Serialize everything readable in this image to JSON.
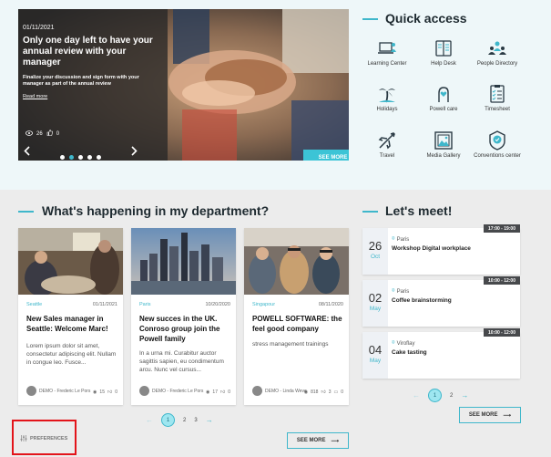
{
  "hero": {
    "date": "01/11/2021",
    "title": "Only one day left to have your annual review with your manager",
    "description": "Finalize your discussion and sign form with your manager as part of the annual review",
    "read_more": "Read more",
    "views": "26",
    "likes": "0",
    "prev_icon": "chevron-left-icon",
    "next_icon": "chevron-right-icon",
    "slide_count": 5,
    "active_slide": 2,
    "see_more": "SEE MORE"
  },
  "quick_access": {
    "title": "Quick access",
    "items": [
      {
        "label": "Learning Center",
        "icon": "laptop-person-icon"
      },
      {
        "label": "Help Desk",
        "icon": "book-icon"
      },
      {
        "label": "People Directory",
        "icon": "people-icon"
      },
      {
        "label": "Holidays",
        "icon": "palm-tree-icon"
      },
      {
        "label": "Powell care",
        "icon": "hand-heart-icon"
      },
      {
        "label": "Timesheet",
        "icon": "checklist-icon"
      },
      {
        "label": "Travel",
        "icon": "airplane-icon"
      },
      {
        "label": "Media Gallery",
        "icon": "picture-icon"
      },
      {
        "label": "Conventions center",
        "icon": "badge-check-icon"
      }
    ]
  },
  "department": {
    "title": "What's happening in my department?",
    "cards": [
      {
        "location": "Seattle",
        "date": "01/11/2021",
        "title": "New Sales manager in Seattle: Welcome Marc!",
        "excerpt": "Lorem ipsum dolor sit amet, consectetur adipiscing elit. Nullam in congue leo. Fusce...",
        "author": "DEMO - Frederic Le Pors",
        "views": "15",
        "likes": "0",
        "comments": ""
      },
      {
        "location": "Paris",
        "date": "10/20/2020",
        "title": "New succes in the UK. Conroso group join the Powell family",
        "excerpt": "In a urna mi. Curabitur auctor sagittis sapien, eu condimentum arcu. Nunc vel cursus...",
        "author": "DEMO - Frederic Le Pors",
        "views": "17",
        "likes": "0",
        "comments": ""
      },
      {
        "location": "Singapour",
        "date": "08/11/2020",
        "title": "POWELL SOFTWARE: the feel good company",
        "excerpt": "stress management trainings",
        "author": "DEMO - Linda Weve",
        "views": "818",
        "likes": "3",
        "comments": "0"
      }
    ],
    "pager": {
      "current": "1",
      "pages": [
        "2",
        "3"
      ]
    },
    "see_more": "SEE MORE"
  },
  "meet": {
    "title": "Let's meet!",
    "events": [
      {
        "day": "26",
        "month": "Oct",
        "time": "17:00 - 19:00",
        "place": "Paris",
        "title": "Workshop Digital workplace"
      },
      {
        "day": "02",
        "month": "May",
        "time": "10:00 - 12:00",
        "place": "Paris",
        "title": "Coffee brainstorming"
      },
      {
        "day": "04",
        "month": "May",
        "time": "10:00 - 12:00",
        "place": "Viroflay",
        "title": "Cake tasting"
      }
    ],
    "pager": {
      "current": "1",
      "pages": [
        "2"
      ]
    },
    "see_more": "SEE MORE"
  },
  "preferences": {
    "label": "PREFERENCES",
    "icon": "sliders-icon"
  },
  "colors": {
    "accent": "#3fb7cb",
    "highlight": "#e3141a",
    "button": "#3cc4d6"
  }
}
